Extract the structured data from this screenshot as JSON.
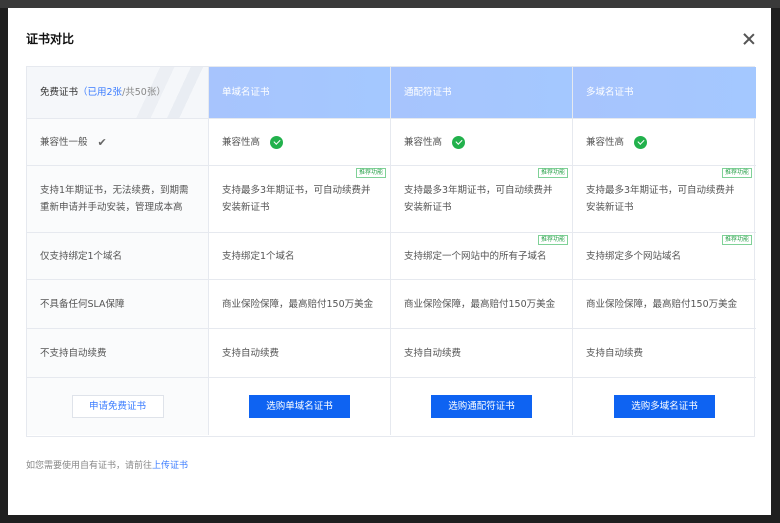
{
  "modal": {
    "title": "证书对比",
    "close_label": "×"
  },
  "header": {
    "free_label": "免费证书",
    "free_used": "（已用2张",
    "free_total": "/共50张）",
    "single": "单域名证书",
    "wildcard": "通配符证书",
    "multi": "多域名证书"
  },
  "rows": {
    "compat": {
      "free": "兼容性一般",
      "single": "兼容性高",
      "wildcard": "兼容性高",
      "multi": "兼容性高"
    },
    "period": {
      "free": "支持1年期证书，无法续费，到期需重新申请并手动安装，管理成本高",
      "single": "支持最多3年期证书，可自动续费并安装新证书",
      "wildcard": "支持最多3年期证书，可自动续费并安装新证书",
      "multi": "支持最多3年期证书，可自动续费并安装新证书"
    },
    "domain": {
      "free": "仅支持绑定1个域名",
      "single": "支持绑定1个域名",
      "wildcard": "支持绑定一个网站中的所有子域名",
      "multi": "支持绑定多个网站域名"
    },
    "sla": {
      "free": "不具备任何SLA保障",
      "single": "商业保险保障，最高赔付150万美金",
      "wildcard": "商业保险保障，最高赔付150万美金",
      "multi": "商业保险保障，最高赔付150万美金"
    },
    "renew": {
      "free": "不支持自动续费",
      "single": "支持自动续费",
      "wildcard": "支持自动续费",
      "multi": "支持自动续费"
    }
  },
  "badge_label": "推荐功能",
  "buttons": {
    "apply_free": "申请免费证书",
    "buy_single": "选购单域名证书",
    "buy_wildcard": "选购通配符证书",
    "buy_multi": "选购多域名证书"
  },
  "footer": {
    "text": "如您需要使用自有证书，请前往",
    "link": "上传证书"
  },
  "colors": {
    "primary": "#0e63f2",
    "header_blue": "#a7c4fd",
    "check_green": "#22b14c"
  }
}
